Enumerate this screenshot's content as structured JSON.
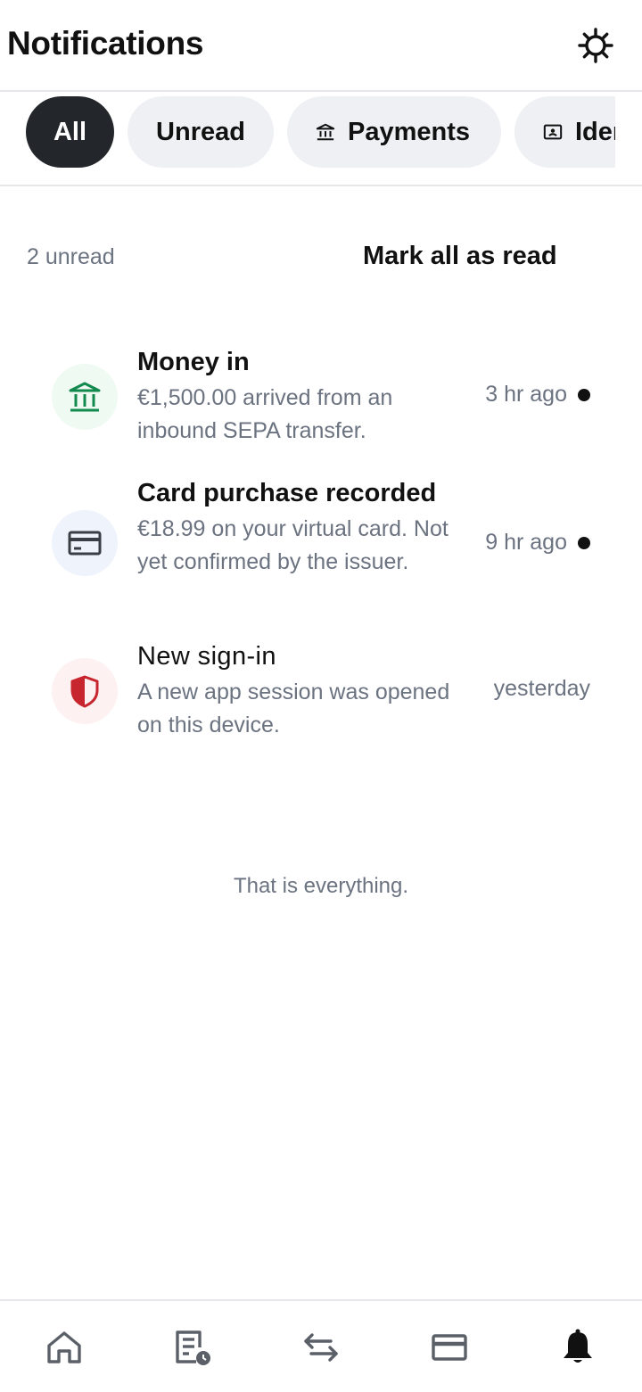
{
  "header": {
    "title": "Notifications",
    "settings_icon": "gear-icon"
  },
  "tabs": [
    {
      "label": "All",
      "active": true
    },
    {
      "label": "Unread",
      "active": false
    },
    {
      "label": "Payments",
      "icon": "bank-icon",
      "active": false
    },
    {
      "label": "Identity",
      "icon": "id-card-icon",
      "active": false
    }
  ],
  "summary": {
    "unread_count": "2 unread",
    "mark_all_label": "Mark all as read"
  },
  "notifications": [
    {
      "title": "Money in",
      "body": "€1,500.00 arrived from an inbound SEPA transfer.",
      "time": "3 hr ago",
      "unread": true,
      "icon": "bank-icon",
      "icon_color": "#138a4d",
      "icon_bg": "#effaf3"
    },
    {
      "title": "Card purchase recorded",
      "body": "€18.99 on your virtual card. Not yet confirmed by the issuer.",
      "time": "9 hr ago",
      "unread": true,
      "icon": "card-icon",
      "icon_color": "#3a3f45",
      "icon_bg": "#eff3fb"
    },
    {
      "title": "New sign-in",
      "body": "A new app session was opened on this device.",
      "time": "yesterday",
      "unread": false,
      "icon": "shield-icon",
      "icon_color": "#c8262f",
      "icon_bg": "#fdf1f1"
    }
  ],
  "footer_note": "That is everything.",
  "bottom_nav": [
    {
      "name": "home",
      "icon": "home-icon",
      "active": false
    },
    {
      "name": "activity",
      "icon": "activity-icon",
      "active": false
    },
    {
      "name": "transfers",
      "icon": "transfer-icon",
      "active": false
    },
    {
      "name": "cards",
      "icon": "card-icon",
      "active": false
    },
    {
      "name": "notifications",
      "icon": "bell-icon",
      "active": true
    }
  ]
}
